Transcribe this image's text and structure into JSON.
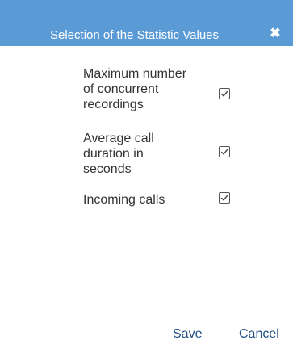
{
  "dialog": {
    "title": "Selection of the Statistic Values",
    "close_icon": "close-icon",
    "options": [
      {
        "label_lines": [
          "Maximum number",
          "of concurrent",
          "recordings"
        ],
        "checked": true
      },
      {
        "label_lines": [
          "Average call",
          "duration in",
          "seconds"
        ],
        "checked": true
      },
      {
        "label_lines": [
          "Incoming calls"
        ],
        "checked": true
      }
    ],
    "save_label": "Save",
    "cancel_label": "Cancel"
  },
  "colors": {
    "header_bg": "#5b9bd5",
    "text": "#333333",
    "button_text": "#1f4f86"
  }
}
